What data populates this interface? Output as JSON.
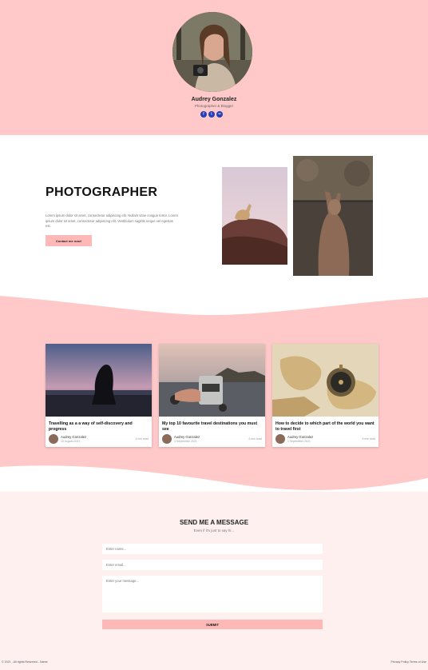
{
  "profile": {
    "name": "Audrey Gonzalez",
    "role": "Photographer & Blogger",
    "socials": [
      {
        "icon": "facebook-icon",
        "glyph": "f"
      },
      {
        "icon": "twitter-icon",
        "glyph": "t"
      },
      {
        "icon": "flickr-icon",
        "glyph": "••"
      }
    ]
  },
  "intro": {
    "heading": "PHOTOGRAPHER",
    "text": "Lorem ipsum dolor sit amet, consectetur adipiscing elit. Nullam vitae congue tortor. Lorem ipsum dolor sit amet, consectetur adipiscing elit. Vestibulum sagittis neque vel egestas est.",
    "button": "Contact me now!"
  },
  "posts": [
    {
      "title": "Travelling as a a way of self-discovery and progress",
      "author": "Audrey Gonzalez",
      "date": "15 August 2021",
      "read": "4 min read"
    },
    {
      "title": "My top 10 favourite travel destinations you must see",
      "author": "Audrey Gonzalez",
      "date": "3 September 2021",
      "read": "6 min read"
    },
    {
      "title": "How to decide to which part of the world you want to travel first",
      "author": "Audrey Gonzalez",
      "date": "1 September 2021",
      "read": "5 min read"
    }
  ],
  "contact": {
    "title": "SEND ME A MESSAGE",
    "subtitle": "Even if it's just to say hi...",
    "name_placeholder": "Enter name...",
    "email_placeholder": "Enter email...",
    "message_placeholder": "Enter your message...",
    "submit": "SUBMIT"
  },
  "footer": {
    "left": "© 2021 - All rights Reserved - Name",
    "right": "Privacy Policy  Terms of Use"
  },
  "colors": {
    "accent": "#ffc9c9",
    "button": "#ffb8b8",
    "social": "#2340b5"
  }
}
